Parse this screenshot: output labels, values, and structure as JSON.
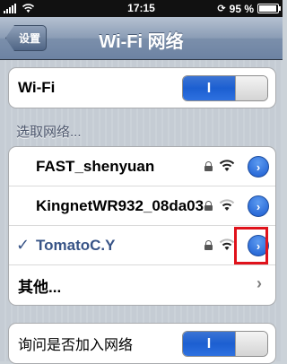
{
  "status_bar": {
    "time": "17:15",
    "battery": "95 %",
    "battery_level": 0.95
  },
  "nav": {
    "back_label": "设置",
    "title": "Wi-Fi 网络"
  },
  "wifi_toggle": {
    "label": "Wi-Fi",
    "state_text": "I"
  },
  "section_header": "选取网络...",
  "networks": [
    {
      "name": "FAST_shenyuan",
      "selected": false
    },
    {
      "name": "KingnetWR932_08da03",
      "selected": false
    },
    {
      "name": "TomatoC.Y",
      "selected": true
    }
  ],
  "checkmark": "✓",
  "other_label": "其他...",
  "ask_join": {
    "label": "询问是否加入网络",
    "state_text": "I"
  },
  "colors": {
    "accent_blue": "#1c5fd1",
    "selected_text": "#385487",
    "highlight_box": "#e0121b"
  }
}
